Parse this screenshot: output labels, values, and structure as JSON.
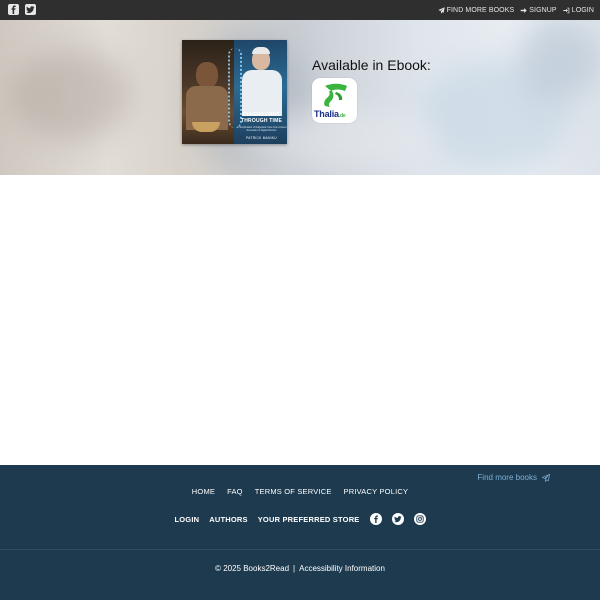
{
  "topbar": {
    "social": [
      {
        "icon": "facebook-icon"
      },
      {
        "icon": "twitter-icon"
      }
    ],
    "links": [
      {
        "label": "FIND MORE BOOKS",
        "icon": "paper-plane-icon"
      },
      {
        "label": "SIGNUP",
        "icon": "arrow-right-icon"
      },
      {
        "label": "LOGIN",
        "icon": "sign-in-icon"
      }
    ]
  },
  "book": {
    "cover_title": "DIAGNOSTICS THROUGH TIME",
    "cover_subtitle": "An Exploration of Diagnostic Care from Ancient Remedies to Digital Doctors",
    "cover_author": "PATRICK MANIKU"
  },
  "ebook": {
    "label": "Available in Ebook:",
    "stores": [
      {
        "name": "Thalia",
        "suffix": ".de",
        "icon": "thalia-logo-icon",
        "brand_color": "#3ab43e",
        "text_color": "#1c2f86"
      }
    ]
  },
  "footer": {
    "find_more": "Find more books",
    "nav": [
      "HOME",
      "FAQ",
      "TERMS OF SERVICE",
      "PRIVACY POLICY"
    ],
    "nav2": [
      "LOGIN",
      "AUTHORS",
      "YOUR PREFERRED STORE"
    ],
    "social": [
      "facebook-icon",
      "twitter-icon",
      "instagram-icon"
    ],
    "copyright": "© 2025 Books2Read",
    "separator": "|",
    "accessibility": "Accessibility Information",
    "background": "#1d3a4f"
  }
}
